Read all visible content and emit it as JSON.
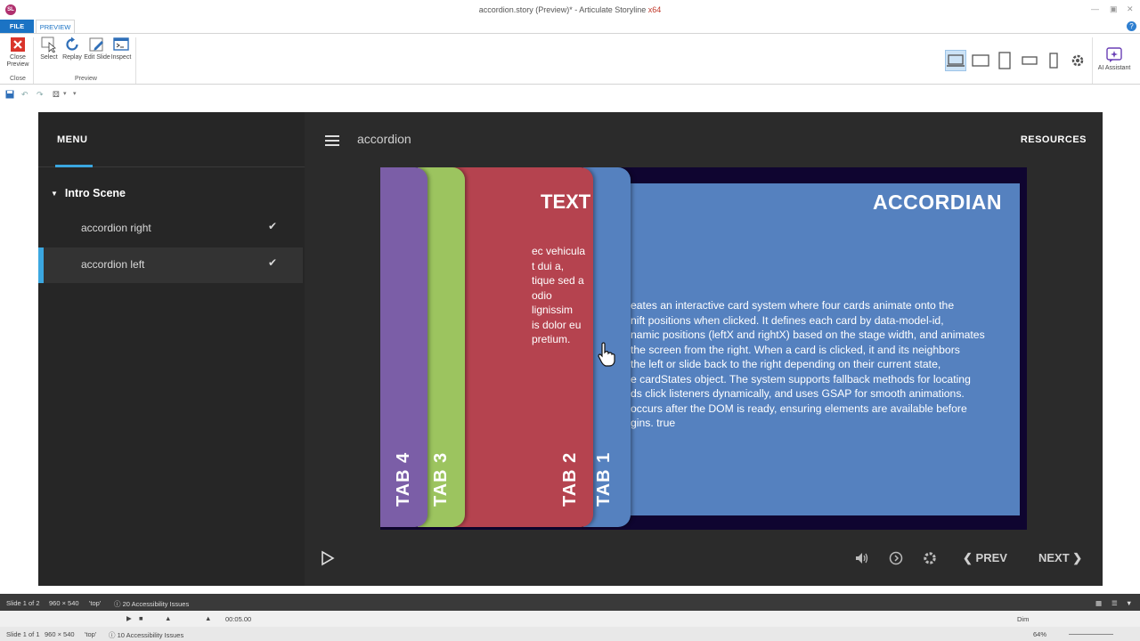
{
  "window": {
    "title": "accordion.story (Preview)* - Articulate Storyline",
    "arch": "x64",
    "logo_text": "SL"
  },
  "ribbon": {
    "tabs": [
      "FILE",
      "PREVIEW"
    ],
    "buttons": {
      "close_preview": "Close Preview",
      "select": "Select",
      "replay": "Replay",
      "edit_slide": "Edit Slide",
      "inspect": "Inspect"
    },
    "groups": {
      "close": "Close",
      "preview": "Preview"
    },
    "ai_assistant": "AI Assistant",
    "active_device": "desktop"
  },
  "player": {
    "menu": {
      "title": "MENU",
      "scene": "Intro Scene",
      "items": [
        {
          "label": "accordion right",
          "visited": true,
          "active": false
        },
        {
          "label": "accordion left",
          "visited": true,
          "active": true
        }
      ]
    },
    "slide_title": "accordion",
    "resources": "RESOURCES",
    "prev": "PREV",
    "next": "NEXT"
  },
  "slide": {
    "tabs": [
      "TAB 4",
      "TAB 3",
      "TAB 2",
      "TAB 1"
    ],
    "colors": {
      "tab4": "#7b5ea7",
      "tab3": "#9cc45f",
      "tab2": "#b5434f",
      "tab1": "#5581bf",
      "stage_bg": "#0f0530"
    },
    "main_heading": "ACCORDIAN",
    "main_body": "eates an interactive card system where four cards animate onto the\nnift positions when clicked. It defines each card by data-model-id,\nnamic positions (leftX and rightX) based on the stage width, and animates\n the screen from the right. When a card is clicked, it and its neighbors\n the left or slide back to the right depending on their current state,\ne cardStates object. The system supports fallback methods for locating\nds click listeners dynamically, and uses GSAP for smooth animations.\noccurs after the DOM is ready, ensuring elements are available before\ngins. true",
    "red_heading": "TEXT",
    "red_body": "ec vehicula\nt dui a,\ntique sed a\n odio\nlignissim\nis dolor eu\n pretium."
  },
  "status": {
    "slide_count": "Slide 1 of 2",
    "dimensions": "960 × 540",
    "layer": "'top'",
    "accessibility": "20 Accessibility Issues",
    "timecode": "00:05.00",
    "slide_count_2": "Slide 1 of 1",
    "accessibility_2": "10 Accessibility Issues",
    "zoom": "64%",
    "dim": "Dim"
  }
}
